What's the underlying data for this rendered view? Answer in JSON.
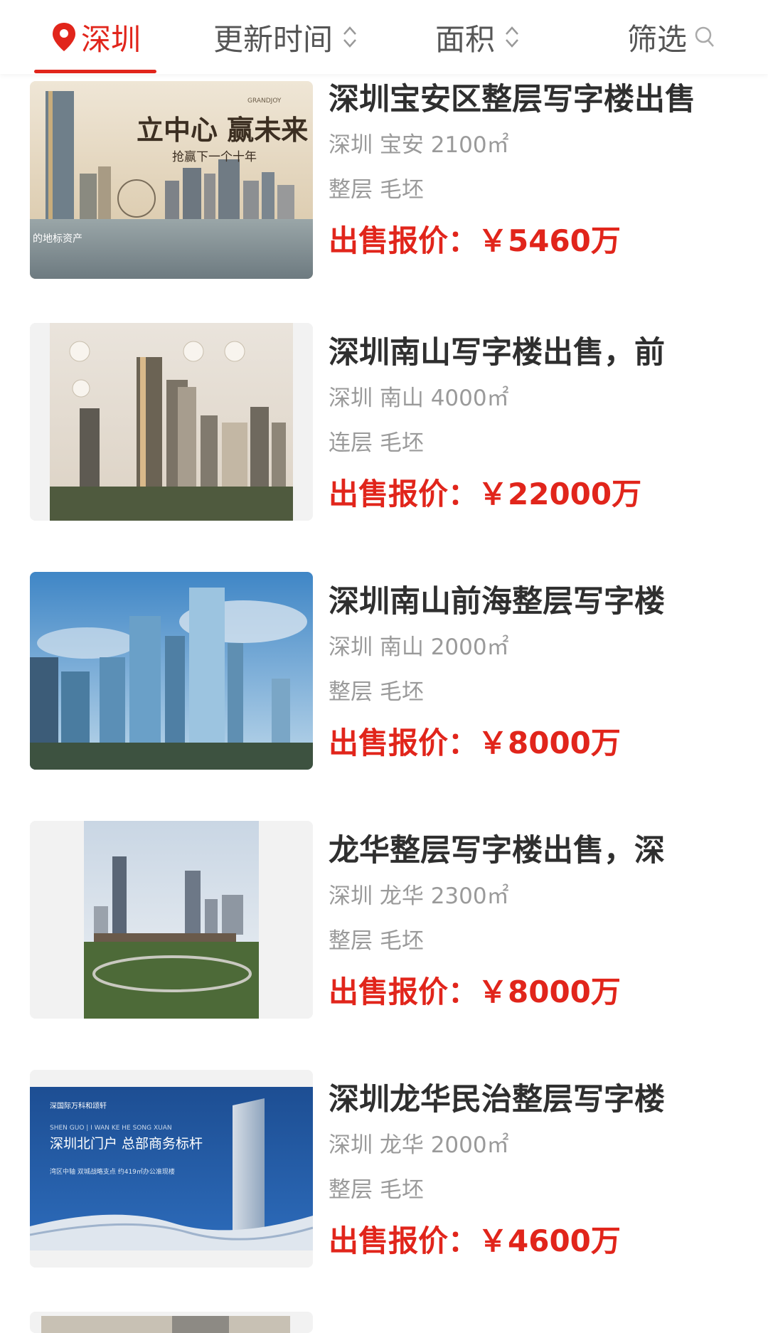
{
  "filter_bar": {
    "city": "深圳",
    "update_time": "更新时间",
    "area": "面积",
    "filter": "筛选"
  },
  "listings": [
    {
      "title": "深圳宝安区整层写字楼出售",
      "location": "深圳 宝安 2100㎡",
      "tags": "整层 毛坯",
      "price": "出售报价：￥5460万",
      "image_text": {
        "slogan": "立中心 赢未来",
        "sub": "抢赢下一个十年",
        "brand": "GRANDJOY",
        "caption": "的地标资产"
      }
    },
    {
      "title": "深圳南山写字楼出售，前",
      "location": "深圳 南山 4000㎡",
      "tags": "连层 毛坯",
      "price": "出售报价：￥22000万"
    },
    {
      "title": "深圳南山前海整层写字楼",
      "location": "深圳 南山 2000㎡",
      "tags": "整层 毛坯",
      "price": "出售报价：￥8000万"
    },
    {
      "title": "龙华整层写字楼出售，深",
      "location": "深圳 龙华 2300㎡",
      "tags": "整层 毛坯",
      "price": "出售报价：￥8000万"
    },
    {
      "title": "深圳龙华民治整层写字楼",
      "location": "深圳 龙华 2000㎡",
      "tags": "整层 毛坯",
      "price": "出售报价：￥4600万",
      "image_text": {
        "brand": "深国际万科和颂轩",
        "en": "SHEN GUO | I WAN KE HE SONG XUAN",
        "headline": "深圳北门户 总部商务标杆",
        "sub": "湾区中轴 双城战略支点 约419㎡办公准现楼"
      }
    }
  ]
}
